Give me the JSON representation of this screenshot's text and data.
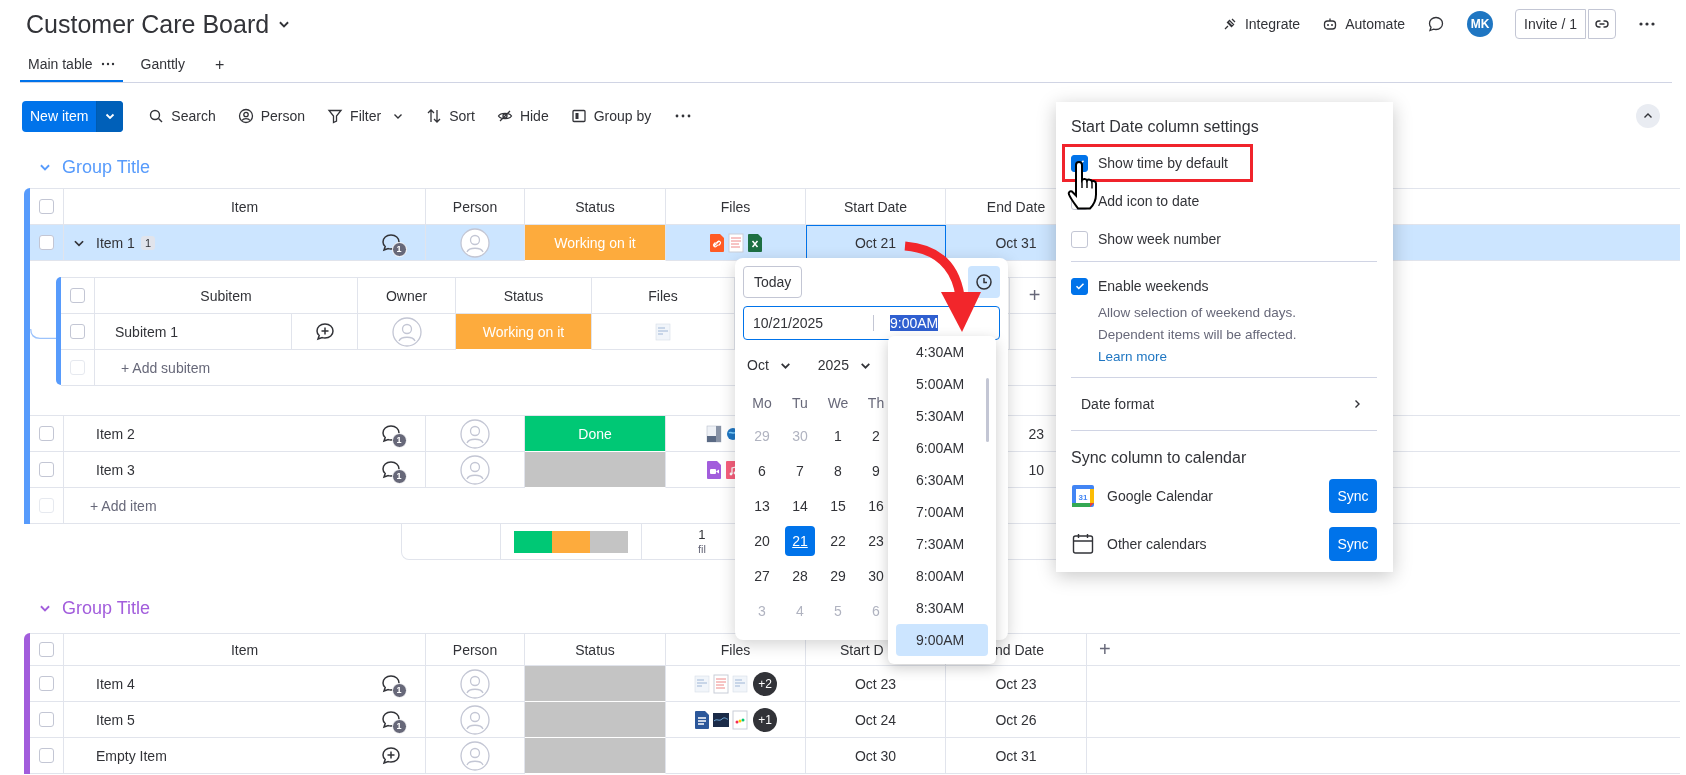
{
  "board": {
    "title": "Customer Care Board"
  },
  "top_actions": {
    "integrate": "Integrate",
    "automate": "Automate",
    "avatar": "MK",
    "invite": "Invite / 1"
  },
  "views": [
    {
      "label": "Main table",
      "selected": true
    },
    {
      "label": "Ganttly",
      "selected": false
    }
  ],
  "add_view": "+",
  "toolbar": {
    "new_item": "New item",
    "actions": [
      {
        "kind": "search",
        "label": "Search",
        "has_menu": false
      },
      {
        "kind": "person",
        "label": "Person",
        "has_menu": false
      },
      {
        "kind": "filter",
        "label": "Filter",
        "has_menu": true
      },
      {
        "kind": "sort",
        "label": "Sort",
        "has_menu": false
      },
      {
        "kind": "hide",
        "label": "Hide",
        "has_menu": false
      },
      {
        "kind": "group",
        "label": "Group by",
        "has_menu": false
      }
    ]
  },
  "groups": [
    {
      "title": "Group Title",
      "color": "#579bfc",
      "header_checked": false,
      "columns": [
        {
          "label": "Item"
        },
        {
          "label": "Person"
        },
        {
          "label": "Status"
        },
        {
          "label": "Files"
        },
        {
          "label": "Start Date"
        },
        {
          "label": "End Date"
        }
      ],
      "rows": [
        {
          "name": "Item 1",
          "subitem_count": "1",
          "expanded": true,
          "selected": true,
          "checked": false,
          "updates": "1",
          "status": {
            "label": "Working on it",
            "color": "#fdab3d"
          },
          "files": [
            {
              "kind": "link"
            },
            {
              "kind": "doc"
            },
            {
              "kind": "sheet"
            }
          ],
          "start_date": {
            "text": "Oct 21",
            "focused": true
          },
          "end_date": {
            "text": "Oct 31"
          },
          "subitems": {
            "header_checked": false,
            "columns": [
              {
                "label": "Subitem"
              },
              {
                "label": "Owner"
              },
              {
                "label": "Status"
              },
              {
                "label": "Files"
              }
            ],
            "add_column": "+",
            "rows": [
              {
                "name": "Subitem 1",
                "checked": false,
                "status": {
                  "label": "Working on it",
                  "color": "#fdab3d"
                },
                "files": [
                  {
                    "kind": "thumb"
                  }
                ]
              }
            ],
            "add_row": {
              "label": "+ Add subitem",
              "checked": false
            }
          }
        },
        {
          "name": "Item 2",
          "selected": false,
          "checked": false,
          "updates": "1",
          "status": {
            "label": "Done",
            "color": "#00c875"
          },
          "files": [
            {
              "kind": "image"
            },
            {
              "kind": "globe"
            }
          ],
          "files_clipped_right": true,
          "end_date": {
            "text": "23",
            "clipped_left": true
          }
        },
        {
          "name": "Item 3",
          "selected": false,
          "checked": false,
          "updates": "1",
          "status": {
            "color": "#c4c4c4"
          },
          "files": [
            {
              "kind": "video"
            },
            {
              "kind": "music"
            }
          ],
          "files_clipped_right": true,
          "end_date": {
            "text": "10",
            "clipped_left": true
          }
        }
      ],
      "add_row": {
        "label": "+ Add item",
        "checked": false
      },
      "summary": {
        "segments": [
          {
            "color": "#00c875"
          },
          {
            "color": "#fdab3d"
          },
          {
            "color": "#c4c4c4"
          }
        ],
        "files": {
          "text": "1",
          "clipped_right": true
        },
        "files_label": "fil"
      }
    },
    {
      "title": "Group Title",
      "color": "#a25ddc",
      "header_checked": false,
      "columns": [
        {
          "label": "Item"
        },
        {
          "label": "Person"
        },
        {
          "label": "Status"
        },
        {
          "label": "Files"
        },
        {
          "label": "Start D",
          "clipped_right": true
        },
        {
          "label": "nd Date",
          "clipped_left": true
        }
      ],
      "add_column": "+",
      "rows": [
        {
          "name": "Item 4",
          "selected": false,
          "checked": false,
          "updates": "1",
          "status": {
            "color": "#c4c4c4"
          },
          "files": [
            {
              "kind": "thumb"
            },
            {
              "kind": "doc"
            },
            {
              "kind": "thumb"
            }
          ],
          "more_files": "+2",
          "start_date": {
            "text": "Oct 23"
          },
          "end_date": {
            "text": "Oct 23"
          }
        },
        {
          "name": "Item 5",
          "selected": false,
          "checked": false,
          "updates": "1",
          "status": {
            "color": "#c4c4c4"
          },
          "files": [
            {
              "kind": "word"
            },
            {
              "kind": "photo"
            },
            {
              "kind": "logo"
            }
          ],
          "more_files": "+1",
          "start_date": {
            "text": "Oct 24"
          },
          "end_date": {
            "text": "Oct 26"
          }
        },
        {
          "name": "Empty Item",
          "selected": false,
          "checked": false,
          "status": {
            "color": "#c4c4c4"
          },
          "files": [],
          "start_date": {
            "text": "Oct 30"
          },
          "end_date": {
            "text": "Oct 31"
          }
        }
      ]
    }
  ],
  "date_picker": {
    "today": "Today",
    "time_enabled": true,
    "date_value": "10/21/2025",
    "time_value": "9:00AM",
    "time_selected": true,
    "month": "Oct",
    "year": "2025",
    "weekdays": [
      "Mo",
      "Tu",
      "We",
      "Th"
    ],
    "weeks": [
      [
        {
          "day": "29",
          "outside": true,
          "selected": false
        },
        {
          "day": "30",
          "outside": true,
          "selected": false
        },
        {
          "day": "1",
          "outside": false,
          "selected": false
        },
        {
          "day": "2",
          "outside": false,
          "selected": false
        }
      ],
      [
        {
          "day": "6",
          "outside": false,
          "selected": false
        },
        {
          "day": "7",
          "outside": false,
          "selected": false
        },
        {
          "day": "8",
          "outside": false,
          "selected": false
        },
        {
          "day": "9",
          "outside": false,
          "selected": false
        }
      ],
      [
        {
          "day": "13",
          "outside": false,
          "selected": false
        },
        {
          "day": "14",
          "outside": false,
          "selected": false
        },
        {
          "day": "15",
          "outside": false,
          "selected": false
        },
        {
          "day": "16",
          "outside": false,
          "selected": false
        }
      ],
      [
        {
          "day": "20",
          "outside": false,
          "selected": false
        },
        {
          "day": "21",
          "outside": false,
          "selected": true
        },
        {
          "day": "22",
          "outside": false,
          "selected": false
        },
        {
          "day": "23",
          "outside": false,
          "selected": false
        }
      ],
      [
        {
          "day": "27",
          "outside": false,
          "selected": false
        },
        {
          "day": "28",
          "outside": false,
          "selected": false
        },
        {
          "day": "29",
          "outside": false,
          "selected": false
        },
        {
          "day": "30",
          "outside": false,
          "selected": false
        }
      ],
      [
        {
          "day": "3",
          "outside": true,
          "selected": false
        },
        {
          "day": "4",
          "outside": true,
          "selected": false
        },
        {
          "day": "5",
          "outside": true,
          "selected": false
        },
        {
          "day": "6",
          "outside": true,
          "selected": false
        }
      ]
    ],
    "times": [
      {
        "label": "4:30AM",
        "selected": false
      },
      {
        "label": "5:00AM",
        "selected": false
      },
      {
        "label": "5:30AM",
        "selected": false
      },
      {
        "label": "6:00AM",
        "selected": false
      },
      {
        "label": "6:30AM",
        "selected": false
      },
      {
        "label": "7:00AM",
        "selected": false
      },
      {
        "label": "7:30AM",
        "selected": false
      },
      {
        "label": "8:00AM",
        "selected": false
      },
      {
        "label": "8:30AM",
        "selected": false
      },
      {
        "label": "9:00AM",
        "selected": true
      }
    ]
  },
  "settings": {
    "title": "Start Date column settings",
    "options": [
      {
        "label": "Show time by default",
        "checked": true,
        "highlighted": true
      },
      {
        "label": "Add icon to date",
        "checked": false,
        "highlighted": false
      },
      {
        "label": "Show week number",
        "checked": false,
        "highlighted": false
      },
      {
        "label": "Enable weekends",
        "checked": true,
        "highlighted": false,
        "description": "Allow selection of weekend days. Dependent items will be affected.",
        "link": "Learn more"
      }
    ],
    "date_format": "Date format",
    "sync_title": "Sync column to calendar",
    "calendars": [
      {
        "kind": "google",
        "label": "Google Calendar",
        "icon_text": "31",
        "button": "Sync"
      },
      {
        "kind": "other",
        "label": "Other calendars",
        "button": "Sync"
      }
    ]
  }
}
